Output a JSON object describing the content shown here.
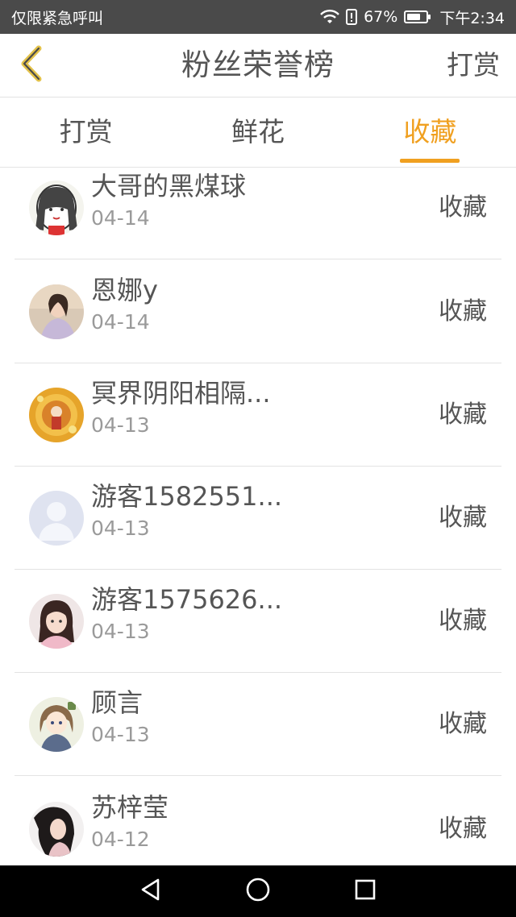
{
  "status_bar": {
    "carrier": "仅限紧急呼叫",
    "battery": "67%",
    "time": "下午2:34",
    "icons": [
      "wifi-icon",
      "alert-icon",
      "battery-icon"
    ]
  },
  "header": {
    "title": "粉丝荣誉榜",
    "action_label": "打赏"
  },
  "tabs": [
    {
      "label": "打赏",
      "active": false
    },
    {
      "label": "鲜花",
      "active": false
    },
    {
      "label": "收藏",
      "active": true
    }
  ],
  "list": [
    {
      "name": "大哥的黑煤球",
      "date": "04-14",
      "action": "收藏",
      "avatar": "cartoon-girl-avatar"
    },
    {
      "name": "恩娜y",
      "date": "04-14",
      "action": "收藏",
      "avatar": "photo-girl-avatar"
    },
    {
      "name": "冥界阴阳相隔...",
      "date": "04-13",
      "action": "收藏",
      "avatar": "illustration-avatar"
    },
    {
      "name": "游客1582551...",
      "date": "04-13",
      "action": "收藏",
      "avatar": "default-user-avatar"
    },
    {
      "name": "游客1575626...",
      "date": "04-13",
      "action": "收藏",
      "avatar": "photo-girl-avatar"
    },
    {
      "name": "顾言",
      "date": "04-13",
      "action": "收藏",
      "avatar": "anime-girl-avatar"
    },
    {
      "name": "苏梓莹",
      "date": "04-12",
      "action": "收藏",
      "avatar": "photo-girl-avatar"
    }
  ],
  "colors": {
    "accent": "#f0a020",
    "text": "#555555",
    "subtext": "#9a9a9a",
    "status_bar": "#4a4a4a",
    "nav_bar": "#000000"
  }
}
